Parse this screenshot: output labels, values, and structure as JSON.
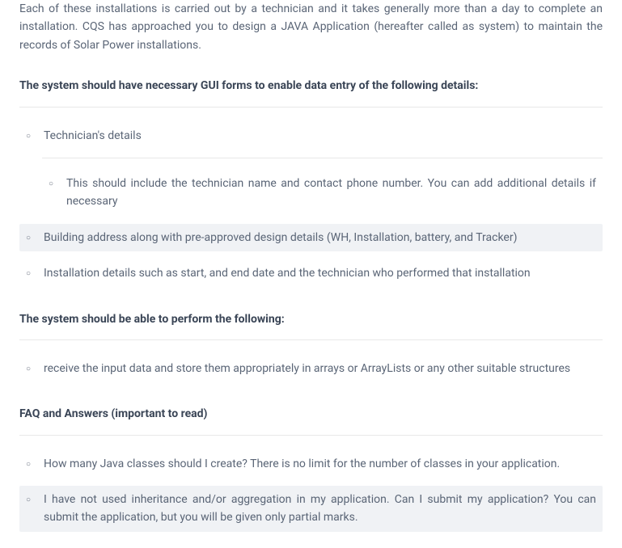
{
  "intro": "Each of these installations is carried out by a technician and it takes generally more than a day to complete an installation. CQS has approached you to design a JAVA Application (hereafter called as system) to maintain the records of Solar Power installations.",
  "sections": {
    "gui": {
      "heading": "The system should have necessary GUI forms to enable data entry of the following details:",
      "items": {
        "tech": {
          "text": "Technician's details",
          "sub": {
            "detail": "This should include the technician name and contact phone number. You can add additional details if necessary"
          }
        },
        "building": {
          "text": "Building address along with pre-approved design details (WH, Installation, battery, and Tracker)"
        },
        "install": {
          "text": "Installation details such as start, and end date and the technician who performed that installation"
        }
      }
    },
    "perform": {
      "heading": "The system should be able to perform the following:",
      "items": {
        "receive": {
          "text": "receive the input data and store them appropriately in arrays or ArrayLists or any other suitable structures"
        }
      }
    },
    "faq": {
      "heading": "FAQ and Answers (important to read)",
      "items": {
        "classes": {
          "text": "How many Java classes should I create?  There is no limit for the number of classes in your application."
        },
        "inheritance": {
          "text": "I have not used inheritance and/or aggregation in my application.  Can I submit my application? You can submit the application, but you will be given only partial marks."
        }
      }
    }
  }
}
